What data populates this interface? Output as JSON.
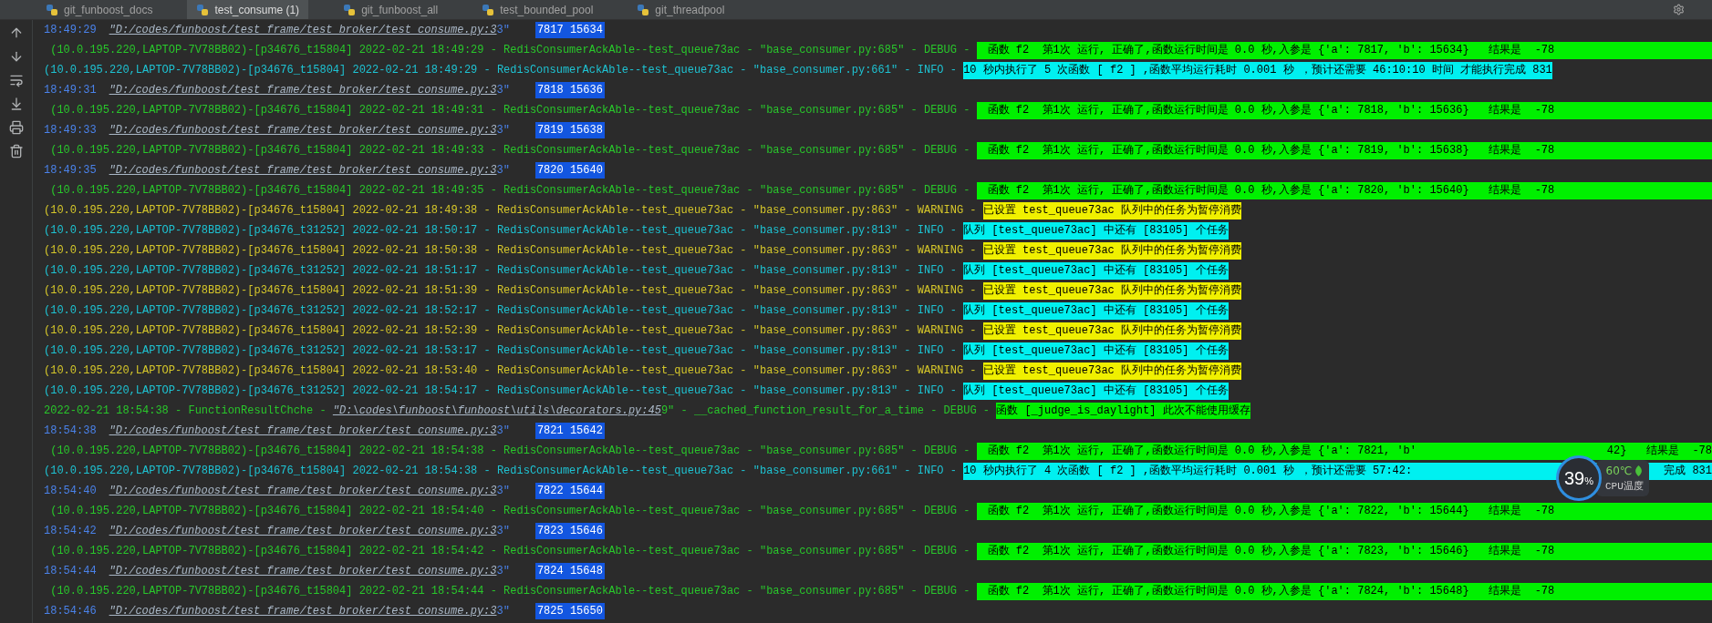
{
  "tabs": [
    {
      "label": "git_funboost_docs",
      "selected": false
    },
    {
      "label": "test_consume (1)",
      "selected": true
    },
    {
      "label": "git_funboost_all",
      "selected": false
    },
    {
      "label": "test_bounded_pool",
      "selected": false
    },
    {
      "label": "git_threadpool",
      "selected": false
    }
  ],
  "console_lines": [
    {
      "kind": "print",
      "time": "18:49:29",
      "link": "\"D:/codes/funboost/test_frame/test_broker/test_consume.py:3",
      "link_tail": "3\"",
      "value": "7817 15634"
    },
    {
      "kind": "debug",
      "prefix": " (10.0.195.220,LAPTOP-7V78BB02)-[p34676_t15804] 2022-02-21 18:49:29 - RedisConsumerAckAble--test_queue73ac - \"base_consumer.py:685\" - DEBUG - ",
      "message": "函数 f2  第1次 运行, 正确了,函数运行时间是 0.0 秒,入参是 {'a': 7817, 'b': 15634}   结果是  -78"
    },
    {
      "kind": "info",
      "prefix": "(10.0.195.220,LAPTOP-7V78BB02)-[p34676_t15804] 2022-02-21 18:49:29 - RedisConsumerAckAble--test_queue73ac - \"base_consumer.py:661\" - INFO - ",
      "message": "10 秒内执行了 5 次函数 [ f2 ] ,函数平均运行耗时 0.001 秒 ，预计还需要 46:10:10 时间 才能执行完成 831"
    },
    {
      "kind": "print",
      "time": "18:49:31",
      "link": "\"D:/codes/funboost/test_frame/test_broker/test_consume.py:3",
      "link_tail": "3\"",
      "value": "7818 15636"
    },
    {
      "kind": "debug",
      "prefix": " (10.0.195.220,LAPTOP-7V78BB02)-[p34676_t15804] 2022-02-21 18:49:31 - RedisConsumerAckAble--test_queue73ac - \"base_consumer.py:685\" - DEBUG - ",
      "message": "函数 f2  第1次 运行, 正确了,函数运行时间是 0.0 秒,入参是 {'a': 7818, 'b': 15636}   结果是  -78"
    },
    {
      "kind": "print",
      "time": "18:49:33",
      "link": "\"D:/codes/funboost/test_frame/test_broker/test_consume.py:3",
      "link_tail": "3\"",
      "value": "7819 15638"
    },
    {
      "kind": "debug",
      "prefix": " (10.0.195.220,LAPTOP-7V78BB02)-[p34676_t15804] 2022-02-21 18:49:33 - RedisConsumerAckAble--test_queue73ac - \"base_consumer.py:685\" - DEBUG - ",
      "message": "函数 f2  第1次 运行, 正确了,函数运行时间是 0.0 秒,入参是 {'a': 7819, 'b': 15638}   结果是  -78"
    },
    {
      "kind": "print",
      "time": "18:49:35",
      "link": "\"D:/codes/funboost/test_frame/test_broker/test_consume.py:3",
      "link_tail": "3\"",
      "value": "7820 15640"
    },
    {
      "kind": "debug",
      "prefix": " (10.0.195.220,LAPTOP-7V78BB02)-[p34676_t15804] 2022-02-21 18:49:35 - RedisConsumerAckAble--test_queue73ac - \"base_consumer.py:685\" - DEBUG - ",
      "message": "函数 f2  第1次 运行, 正确了,函数运行时间是 0.0 秒,入参是 {'a': 7820, 'b': 15640}   结果是  -78"
    },
    {
      "kind": "warning",
      "prefix": "(10.0.195.220,LAPTOP-7V78BB02)-[p34676_t15804] 2022-02-21 18:49:38 - RedisConsumerAckAble--test_queue73ac - \"base_consumer.py:863\" - WARNING - ",
      "message": "已设置 test_queue73ac 队列中的任务为暂停消费"
    },
    {
      "kind": "info",
      "prefix": "(10.0.195.220,LAPTOP-7V78BB02)-[p34676_t31252] 2022-02-21 18:50:17 - RedisConsumerAckAble--test_queue73ac - \"base_consumer.py:813\" - INFO - ",
      "message": "队列 [test_queue73ac] 中还有 [83105] 个任务"
    },
    {
      "kind": "warning",
      "prefix": "(10.0.195.220,LAPTOP-7V78BB02)-[p34676_t15804] 2022-02-21 18:50:38 - RedisConsumerAckAble--test_queue73ac - \"base_consumer.py:863\" - WARNING - ",
      "message": "已设置 test_queue73ac 队列中的任务为暂停消费"
    },
    {
      "kind": "info",
      "prefix": "(10.0.195.220,LAPTOP-7V78BB02)-[p34676_t31252] 2022-02-21 18:51:17 - RedisConsumerAckAble--test_queue73ac - \"base_consumer.py:813\" - INFO - ",
      "message": "队列 [test_queue73ac] 中还有 [83105] 个任务"
    },
    {
      "kind": "warning",
      "prefix": "(10.0.195.220,LAPTOP-7V78BB02)-[p34676_t15804] 2022-02-21 18:51:39 - RedisConsumerAckAble--test_queue73ac - \"base_consumer.py:863\" - WARNING - ",
      "message": "已设置 test_queue73ac 队列中的任务为暂停消费"
    },
    {
      "kind": "info",
      "prefix": "(10.0.195.220,LAPTOP-7V78BB02)-[p34676_t31252] 2022-02-21 18:52:17 - RedisConsumerAckAble--test_queue73ac - \"base_consumer.py:813\" - INFO - ",
      "message": "队列 [test_queue73ac] 中还有 [83105] 个任务"
    },
    {
      "kind": "warning",
      "prefix": "(10.0.195.220,LAPTOP-7V78BB02)-[p34676_t15804] 2022-02-21 18:52:39 - RedisConsumerAckAble--test_queue73ac - \"base_consumer.py:863\" - WARNING - ",
      "message": "已设置 test_queue73ac 队列中的任务为暂停消费"
    },
    {
      "kind": "info",
      "prefix": "(10.0.195.220,LAPTOP-7V78BB02)-[p34676_t31252] 2022-02-21 18:53:17 - RedisConsumerAckAble--test_queue73ac - \"base_consumer.py:813\" - INFO - ",
      "message": "队列 [test_queue73ac] 中还有 [83105] 个任务"
    },
    {
      "kind": "warning",
      "prefix": "(10.0.195.220,LAPTOP-7V78BB02)-[p34676_t15804] 2022-02-21 18:53:40 - RedisConsumerAckAble--test_queue73ac - \"base_consumer.py:863\" - WARNING - ",
      "message": "已设置 test_queue73ac 队列中的任务为暂停消费"
    },
    {
      "kind": "info",
      "prefix": "(10.0.195.220,LAPTOP-7V78BB02)-[p34676_t31252] 2022-02-21 18:54:17 - RedisConsumerAckAble--test_queue73ac - \"base_consumer.py:813\" - INFO - ",
      "message": "队列 [test_queue73ac] 中还有 [83105] 个任务"
    },
    {
      "kind": "cache",
      "prefix": "2022-02-21 18:54:38 - FunctionResultChche - ",
      "link": "\"D:\\codes\\funboost\\funboost\\utils\\decorators.py:45",
      "link_tail": "9\" - __cached_function_result_for_a_time - DEBUG - ",
      "message": "函数 [_judge_is_daylight] 此次不能使用缓存"
    },
    {
      "kind": "print",
      "time": "18:54:38",
      "link": "\"D:/codes/funboost/test_frame/test_broker/test_consume.py:3",
      "link_tail": "3\"",
      "value": "7821 15642"
    },
    {
      "kind": "debug",
      "prefix": " (10.0.195.220,LAPTOP-7V78BB02)-[p34676_t15804] 2022-02-21 18:54:38 - RedisConsumerAckAble--test_queue73ac - \"base_consumer.py:685\" - DEBUG - ",
      "message": "函数 f2  第1次 运行, 正确了,函数运行时间是 0.0 秒,入参是 {'a': 7821, 'b'",
      "message_after": "42}   结果是  -78"
    },
    {
      "kind": "info",
      "prefix": "(10.0.195.220,LAPTOP-7V78BB02)-[p34676_t15804] 2022-02-21 18:54:38 - RedisConsumerAckAble--test_queue73ac - \"base_consumer.py:661\" - INFO - ",
      "message": "10 秒内执行了 4 次函数 [ f2 ] ,函数平均运行耗时 0.001 秒 ，预计还需要 57:42:",
      "message_after": "完成 831"
    },
    {
      "kind": "print",
      "time": "18:54:40",
      "link": "\"D:/codes/funboost/test_frame/test_broker/test_consume.py:3",
      "link_tail": "3\"",
      "value": "7822 15644"
    },
    {
      "kind": "debug",
      "prefix": " (10.0.195.220,LAPTOP-7V78BB02)-[p34676_t15804] 2022-02-21 18:54:40 - RedisConsumerAckAble--test_queue73ac - \"base_consumer.py:685\" - DEBUG - ",
      "message": "函数 f2  第1次 运行, 正确了,函数运行时间是 0.0 秒,入参是 {'a': 7822, 'b': 15644}   结果是  -78"
    },
    {
      "kind": "print",
      "time": "18:54:42",
      "link": "\"D:/codes/funboost/test_frame/test_broker/test_consume.py:3",
      "link_tail": "3\"",
      "value": "7823 15646"
    },
    {
      "kind": "debug",
      "prefix": " (10.0.195.220,LAPTOP-7V78BB02)-[p34676_t15804] 2022-02-21 18:54:42 - RedisConsumerAckAble--test_queue73ac - \"base_consumer.py:685\" - DEBUG - ",
      "message": "函数 f2  第1次 运行, 正确了,函数运行时间是 0.0 秒,入参是 {'a': 7823, 'b': 15646}   结果是  -78"
    },
    {
      "kind": "print",
      "time": "18:54:44",
      "link": "\"D:/codes/funboost/test_frame/test_broker/test_consume.py:3",
      "link_tail": "3\"",
      "value": "7824 15648"
    },
    {
      "kind": "debug",
      "prefix": " (10.0.195.220,LAPTOP-7V78BB02)-[p34676_t15804] 2022-02-21 18:54:44 - RedisConsumerAckAble--test_queue73ac - \"base_consumer.py:685\" - DEBUG - ",
      "message": "函数 f2  第1次 运行, 正确了,函数运行时间是 0.0 秒,入参是 {'a': 7824, 'b': 15648}   结果是  -78"
    },
    {
      "kind": "print",
      "time": "18:54:46",
      "link": "\"D:/codes/funboost/test_frame/test_broker/test_consume.py:3",
      "link_tail": "3\"",
      "value": "7825 15650"
    }
  ],
  "cpu_widget": {
    "percent": "39",
    "unit": "%",
    "temperature": "60℃",
    "label": "CPU温度"
  }
}
